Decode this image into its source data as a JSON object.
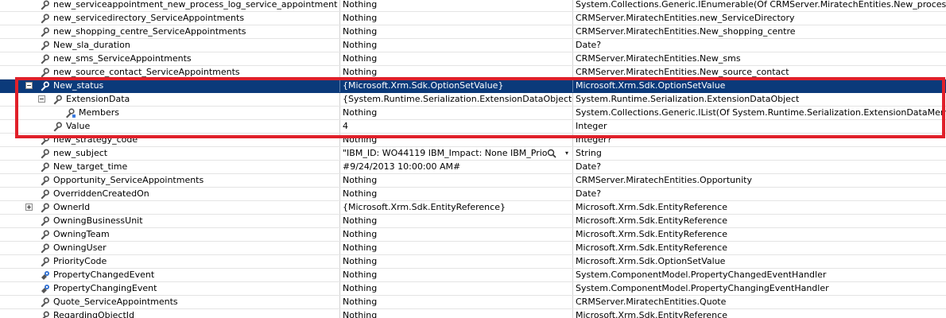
{
  "rows": [
    {
      "name": "new_serviceappointment_new_process_log_service_appointment",
      "value": "Nothing",
      "type": "System.Collections.Generic.IEnumerable(Of CRMServer.MiratechEntities.New_process_lo"
    },
    {
      "name": "new_servicedirectory_ServiceAppointments",
      "value": "Nothing",
      "type": "CRMServer.MiratechEntities.new_ServiceDirectory"
    },
    {
      "name": "new_shopping_centre_ServiceAppointments",
      "value": "Nothing",
      "type": "CRMServer.MiratechEntities.New_shopping_centre"
    },
    {
      "name": "New_sla_duration",
      "value": "Nothing",
      "type": "Date?"
    },
    {
      "name": "new_sms_ServiceAppointments",
      "value": "Nothing",
      "type": "CRMServer.MiratechEntities.New_sms"
    },
    {
      "name": "new_source_contact_ServiceAppointments",
      "value": "Nothing",
      "type": "CRMServer.MiratechEntities.New_source_contact"
    },
    {
      "name": "New_status",
      "value": "{Microsoft.Xrm.Sdk.OptionSetValue}",
      "type": "Microsoft.Xrm.Sdk.OptionSetValue"
    },
    {
      "name": "ExtensionData",
      "value": "{System.Runtime.Serialization.ExtensionDataObject}",
      "type": "System.Runtime.Serialization.ExtensionDataObject"
    },
    {
      "name": "Members",
      "value": "Nothing",
      "type": "System.Collections.Generic.IList(Of System.Runtime.Serialization.ExtensionDataMember"
    },
    {
      "name": "Value",
      "value": "4",
      "type": "Integer"
    },
    {
      "name": "new_strategy_code",
      "value": "Nothing",
      "type": "Integer?"
    },
    {
      "name": "new_subject",
      "value": "\"IBM_ID:  WO44119  IBM_Impact:  None  IBM_Prio",
      "type": "String"
    },
    {
      "name": "New_target_time",
      "value": "#9/24/2013 10:00:00 AM#",
      "type": "Date?"
    },
    {
      "name": "Opportunity_ServiceAppointments",
      "value": "Nothing",
      "type": "CRMServer.MiratechEntities.Opportunity"
    },
    {
      "name": "OverriddenCreatedOn",
      "value": "Nothing",
      "type": "Date?"
    },
    {
      "name": "OwnerId",
      "value": "{Microsoft.Xrm.Sdk.EntityReference}",
      "type": "Microsoft.Xrm.Sdk.EntityReference"
    },
    {
      "name": "OwningBusinessUnit",
      "value": "Nothing",
      "type": "Microsoft.Xrm.Sdk.EntityReference"
    },
    {
      "name": "OwningTeam",
      "value": "Nothing",
      "type": "Microsoft.Xrm.Sdk.EntityReference"
    },
    {
      "name": "OwningUser",
      "value": "Nothing",
      "type": "Microsoft.Xrm.Sdk.EntityReference"
    },
    {
      "name": "PriorityCode",
      "value": "Nothing",
      "type": "Microsoft.Xrm.Sdk.OptionSetValue"
    },
    {
      "name": "PropertyChangedEvent",
      "value": "Nothing",
      "type": "System.ComponentModel.PropertyChangedEventHandler"
    },
    {
      "name": "PropertyChangingEvent",
      "value": "Nothing",
      "type": "System.ComponentModel.PropertyChangingEventHandler"
    },
    {
      "name": "Quote_ServiceAppointments",
      "value": "Nothing",
      "type": "CRMServer.MiratechEntities.Quote"
    },
    {
      "name": "RegardingObjectId",
      "value": "Nothing",
      "type": "Microsoft.Xrm.Sdk.EntityReference"
    }
  ],
  "icons": {
    "property": "wrench-icon",
    "event": "event-icon",
    "member": "member-icon",
    "search": "search-icon",
    "dropdown": "dropdown-arrow-icon"
  },
  "colors": {
    "selection": "#0b3a7a",
    "highlight": "#e0202a"
  }
}
